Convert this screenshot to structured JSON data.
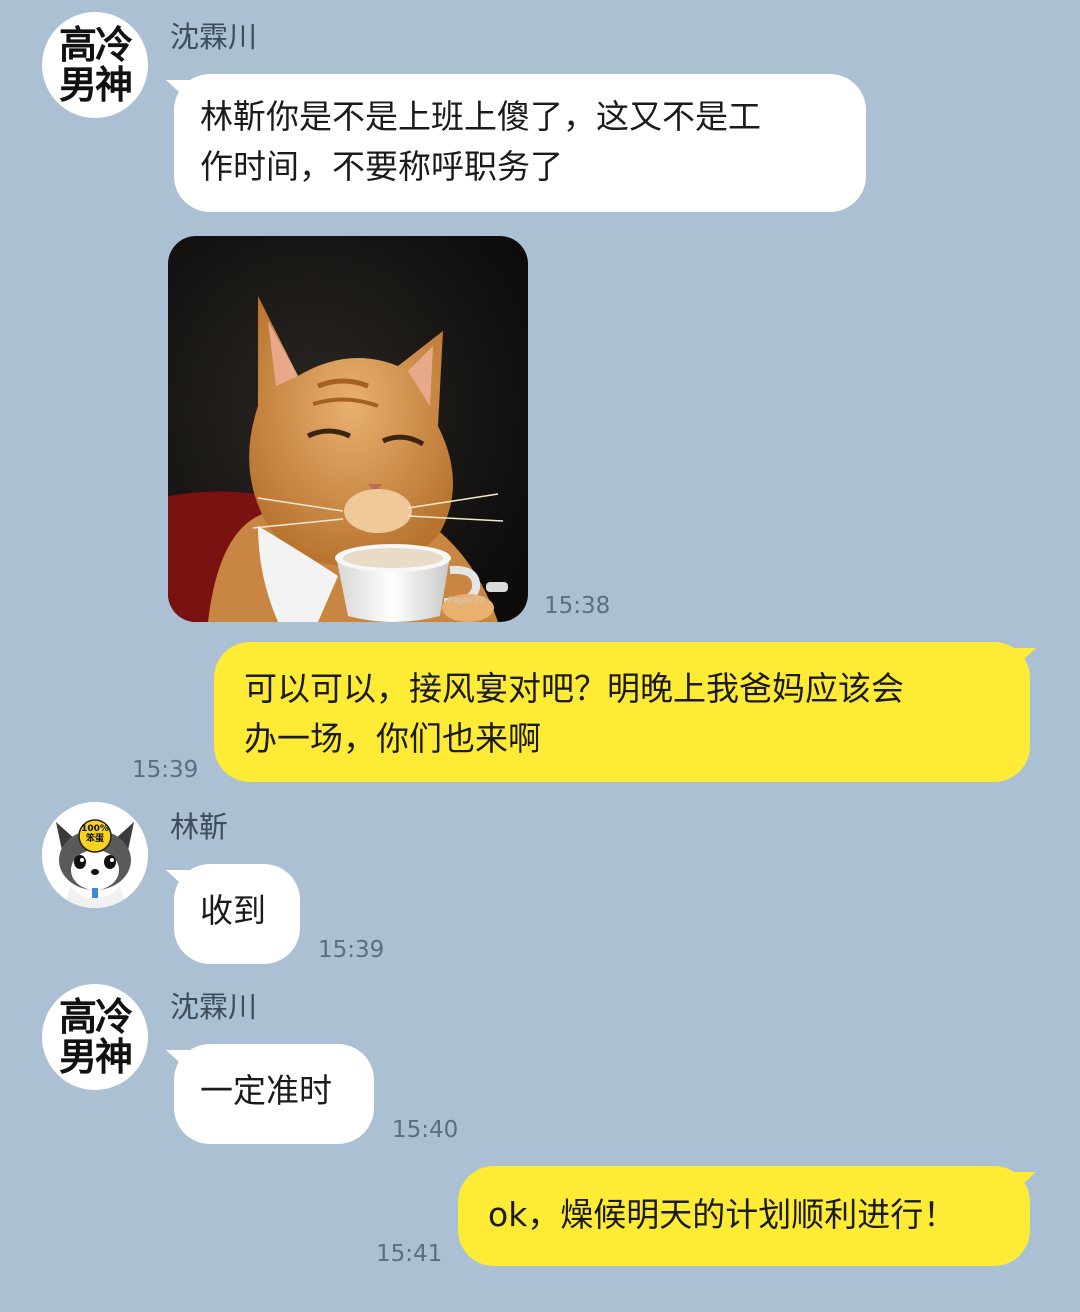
{
  "colors": {
    "background": "#abc0d3",
    "incoming_bubble": "#ffffff",
    "outgoing_bubble": "#fdeb35"
  },
  "contacts": {
    "shen": {
      "name": "沈霖川",
      "avatar_line1": "高冷",
      "avatar_line2": "男神"
    },
    "lin": {
      "name": "林靳",
      "avatar_badge_line1": "100%",
      "avatar_badge_line2": "笨蛋",
      "avatar_icon": "cartoon-dog-avatar-icon"
    }
  },
  "messages": [
    {
      "sender": "沈霖川",
      "text": "林靳你是不是上班上傻了，这又不是工\n作时间，不要称呼职务了"
    },
    {
      "sender": "沈霖川",
      "image_icon": "cat-holding-coffee-cup-icon",
      "watermark": "Paper77",
      "time": "15:38"
    },
    {
      "sender": "me",
      "text": "可以可以，接风宴对吧？明晚上我爸妈应该会\n办一场，你们也来啊",
      "time": "15:39"
    },
    {
      "sender": "林靳",
      "text": "收到",
      "time": "15:39"
    },
    {
      "sender": "沈霖川",
      "text": "一定准时",
      "time": "15:40"
    },
    {
      "sender": "me",
      "text": "ok，燥候明天的计划顺利进行！",
      "time": "15:41"
    }
  ]
}
